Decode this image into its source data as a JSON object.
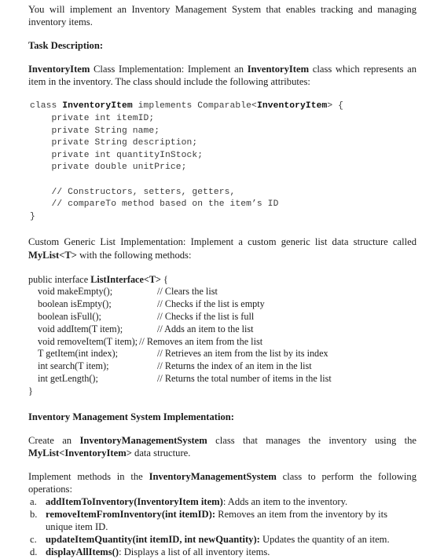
{
  "document": {
    "intro": {
      "text_before": "You will implement an ",
      "emphasis": "Inventory Management System",
      "text_after": " that enables tracking and managing inventory items.",
      "full": "You will implement an Inventory Management System that enables tracking and managing inventory items."
    },
    "task_heading": "Task Description:",
    "inventory_item_para": {
      "bold_1": "InventoryItem",
      "mid": " Class Implementation: Implement an ",
      "bold_2": "InventoryItem",
      "tail": " class which represents an item in the inventory. The class should include the following attributes:"
    },
    "code_block_1": {
      "language": "java",
      "lines": [
        {
          "segments": [
            {
              "t": "class ",
              "b": false
            },
            {
              "t": "InventoryItem",
              "b": true
            },
            {
              "t": " implements Comparable<",
              "b": false
            },
            {
              "t": "InventoryItem",
              "b": true
            },
            {
              "t": "> {",
              "b": false
            }
          ]
        },
        {
          "segments": [
            {
              "t": "    private int itemID;",
              "b": false
            }
          ]
        },
        {
          "segments": [
            {
              "t": "    private String name;",
              "b": false
            }
          ]
        },
        {
          "segments": [
            {
              "t": "    private String description;",
              "b": false
            }
          ]
        },
        {
          "segments": [
            {
              "t": "    private int quantityInStock;",
              "b": false
            }
          ]
        },
        {
          "segments": [
            {
              "t": "    private double unitPrice;",
              "b": false
            }
          ]
        },
        {
          "segments": [
            {
              "t": "",
              "b": false
            }
          ]
        },
        {
          "segments": [
            {
              "t": "    // Constructors, setters, getters,",
              "b": false
            }
          ]
        },
        {
          "segments": [
            {
              "t": "    // compareTo method based on the item’s ID",
              "b": false
            }
          ]
        },
        {
          "segments": [
            {
              "t": "}",
              "b": false
            }
          ]
        }
      ]
    },
    "custom_list_para": {
      "lead": "Custom Generic List Implementation: Implement a custom generic list data structure called ",
      "bold": "MyList<T>",
      "tail": " with the following methods:"
    },
    "interface_block": {
      "open_line": {
        "plain": "public interface ",
        "bold": "ListInterface<T>",
        "tail": " {"
      },
      "methods": [
        {
          "signature": "void makeEmpty();",
          "comment": "// Clears the list",
          "wide": false
        },
        {
          "signature": "boolean isEmpty();",
          "comment": "// Checks if the list is empty",
          "wide": false
        },
        {
          "signature": "boolean isFull();",
          "comment": "// Checks if the list is full",
          "wide": false
        },
        {
          "signature": "void addItem(T item);",
          "comment": "// Adds an item to the list",
          "wide": false
        },
        {
          "signature": "void removeItem(T item);",
          "comment": "// Removes an item from the list",
          "wide": true
        },
        {
          "signature": "T getItem(int index);",
          "comment": "// Retrieves an item from the list by its index",
          "wide": false
        },
        {
          "signature": "int search(T item);",
          "comment": "// Returns the index of an item in the list",
          "wide": false
        },
        {
          "signature": "int getLength();",
          "comment": "// Returns the total number of items in the list",
          "wide": false
        }
      ],
      "close_line": "}"
    },
    "ims_heading": "Inventory Management System Implementation:",
    "create_para": {
      "lead": "Create an ",
      "bold_1": "InventoryManagementSystem",
      "mid": " class that manages the inventory using the ",
      "bold_2": "MyList<InventoryItem>",
      "tail": " data structure."
    },
    "implement_para": {
      "lead": "Implement methods in the ",
      "bold": "InventoryManagementSystem",
      "tail": " class to perform the following operations:"
    },
    "operations": [
      {
        "marker": "a.",
        "bold": "addItemToInventory(InventoryItem item)",
        "rest": ": Adds an item to the inventory."
      },
      {
        "marker": "b.",
        "bold": "removeItemFromInventory(int itemID):",
        "rest": " Removes an item from the inventory by its unique item ID."
      },
      {
        "marker": "c.",
        "bold": "updateItemQuantity(int itemID, int newQuantity):",
        "rest": " Updates the quantity of an item."
      },
      {
        "marker": "d.",
        "bold": "displayAllItems()",
        "rest": ": Displays a list of all inventory items."
      }
    ]
  },
  "colors": {
    "page_background": "#ffffff",
    "body_text": "#1b1b1b",
    "code_text": "#3a3a3a"
  }
}
